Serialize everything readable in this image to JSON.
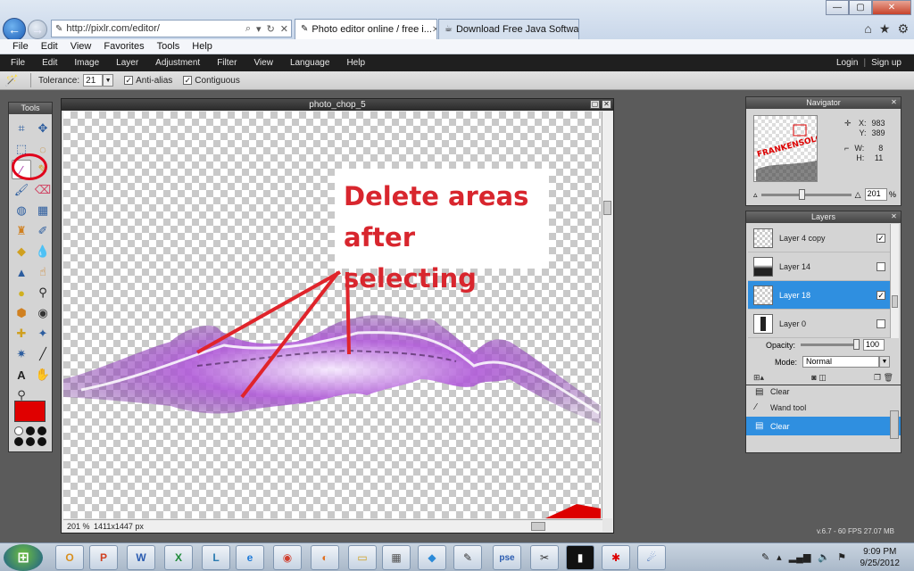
{
  "browser": {
    "url": "http://pixlr.com/editor/",
    "tabs": [
      {
        "label": "Photo editor online / free i...",
        "close": "✕"
      },
      {
        "label": "Download Free Java Software"
      }
    ],
    "controls": {
      "search": "⌕",
      "dropdown": "▾",
      "refresh": "↻",
      "close": "✕"
    },
    "menu": [
      "File",
      "Edit",
      "View",
      "Favorites",
      "Tools",
      "Help"
    ],
    "window_controls": {
      "minimize": "—",
      "maximize": "▢",
      "close": "✕"
    },
    "right_icons": [
      "home-icon",
      "star-icon",
      "gear-icon"
    ]
  },
  "app": {
    "menu": [
      "File",
      "Edit",
      "Image",
      "Layer",
      "Adjustment",
      "Filter",
      "View",
      "Language",
      "Help"
    ],
    "login": "Login",
    "separator": "|",
    "signup": "Sign up"
  },
  "options": {
    "tolerance_label": "Tolerance:",
    "tolerance_value": "21",
    "anti_alias_label": "Anti-alias",
    "anti_alias_checked": true,
    "contiguous_label": "Contiguous",
    "contiguous_checked": true
  },
  "tools": {
    "title": "Tools",
    "active_tool": "magic-wand",
    "icons": [
      "crop",
      "move",
      "marquee",
      "lasso",
      "magic-wand",
      "pencil",
      "brush",
      "eraser",
      "bucket",
      "gradient",
      "clone-stamp",
      "color-replace",
      "drawing",
      "blur",
      "sharpen",
      "smudge",
      "sponge",
      "dodge",
      "burn",
      "red-eye",
      "spot-heal",
      "bloat",
      "pinch",
      "color-picker",
      "type",
      "hand",
      "zoom"
    ],
    "fg_color": "#e00000"
  },
  "canvas": {
    "title": "photo_chop_5",
    "annotation_line1": "Delete areas",
    "annotation_line2": "after selecting",
    "annotation_color": "#d8262e",
    "zoom": "201 %",
    "dimensions": "1411x1447 px"
  },
  "navigator": {
    "title": "Navigator",
    "x_label": "X:",
    "x_value": "983",
    "y_label": "Y:",
    "y_value": "389",
    "w_label": "W:",
    "w_value": "8",
    "h_label": "H:",
    "h_value": "11",
    "zoom_value": "201",
    "zoom_unit": "%"
  },
  "layers": {
    "title": "Layers",
    "items": [
      {
        "name": "Layer 4 copy",
        "checked": true
      },
      {
        "name": "Layer 14",
        "checked": false
      },
      {
        "name": "Layer 18",
        "checked": true,
        "selected": true
      },
      {
        "name": "Layer 0",
        "checked": false
      }
    ],
    "opacity_label": "Opacity:",
    "opacity_value": "100",
    "mode_label": "Mode:",
    "mode_value": "Normal"
  },
  "history": {
    "items": [
      {
        "label": "Clear"
      },
      {
        "label": "Wand tool"
      },
      {
        "label": "Clear",
        "selected": true
      }
    ]
  },
  "status": "v.6.7 - 60 FPS 27.07 MB",
  "taskbar": {
    "time": "9:09 PM",
    "date": "9/25/2012",
    "apps": [
      "outlook",
      "powerpoint",
      "word",
      "excel",
      "lync",
      "internet-explorer",
      "chrome",
      "firefox",
      "explorer",
      "calculator",
      "remote-desktop",
      "paint",
      "pse",
      "cmd",
      "scissors",
      "media",
      "pen"
    ]
  }
}
